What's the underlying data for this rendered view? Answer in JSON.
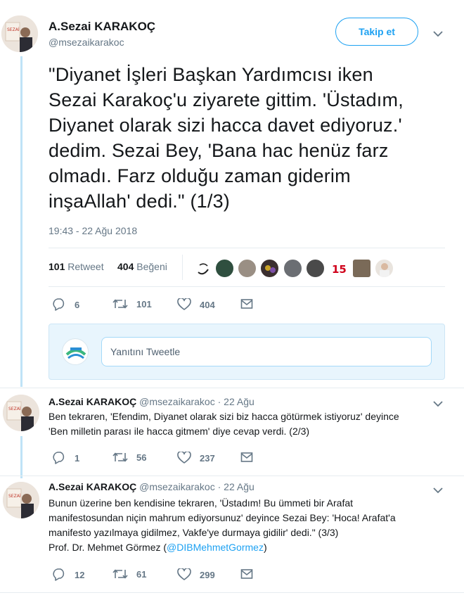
{
  "main_tweet": {
    "name": "A.Sezai KARAKOÇ",
    "handle": "@msezaikarakoc",
    "follow_label": "Takip et",
    "text_lines": [
      "\"Diyanet İşleri Başkan Yardımcısı iken",
      "Sezai Karakoç'u ziyarete gittim. 'Üstadım,",
      "Diyanet olarak sizi hacca davet ediyoruz.'",
      "dedim. Sezai Bey, 'Bana hac henüz farz",
      "olmadı. Farz olduğu zaman giderim",
      "inşaAllah' dedi.\" (1/3)"
    ],
    "timestamp": "19:43 - 22 Ağu 2018",
    "retweet_count": "101",
    "retweet_label": "Retweet",
    "like_count": "404",
    "like_label": "Beğeni",
    "actions": {
      "reply": "6",
      "retweet": "101",
      "like": "404"
    }
  },
  "reply_box": {
    "placeholder": "Yanıtını Tweetle"
  },
  "replies": [
    {
      "name": "A.Sezai KARAKOÇ",
      "handle": "@msezaikarakoc",
      "date": "· 22 Ağu",
      "lines": [
        "Ben tekraren, 'Efendim, Diyanet olarak sizi biz hacca götürmek istiyoruz' deyince",
        "'Ben milletin parası ile hacca gitmem' diye cevap verdi. (2/3)"
      ],
      "actions": {
        "reply": "1",
        "retweet": "56",
        "like": "237"
      }
    },
    {
      "name": "A.Sezai KARAKOÇ",
      "handle": "@msezaikarakoc",
      "date": "· 22 Ağu",
      "lines": [
        "Bunun üzerine ben kendisine tekraren, 'Üstadım! Bu ümmeti bir Arafat",
        "manifestosundan niçin mahrum ediyorsunuz' deyince Sezai Bey: 'Hoca! Arafat'a",
        "manifesto yazılmaya gidilmez, Vakfe'ye durmaya gidilir' dedi.\" (3/3)"
      ],
      "author_prefix": "Prof. Dr. Mehmet Görmez (",
      "author_link": "@DIBMehmetGormez",
      "author_suffix": ")",
      "actions": {
        "reply": "12",
        "retweet": "61",
        "like": "299"
      }
    }
  ],
  "colors": {
    "accent": "#1da1f2",
    "muted": "#657786",
    "thread_line": "#bfe3f7"
  }
}
